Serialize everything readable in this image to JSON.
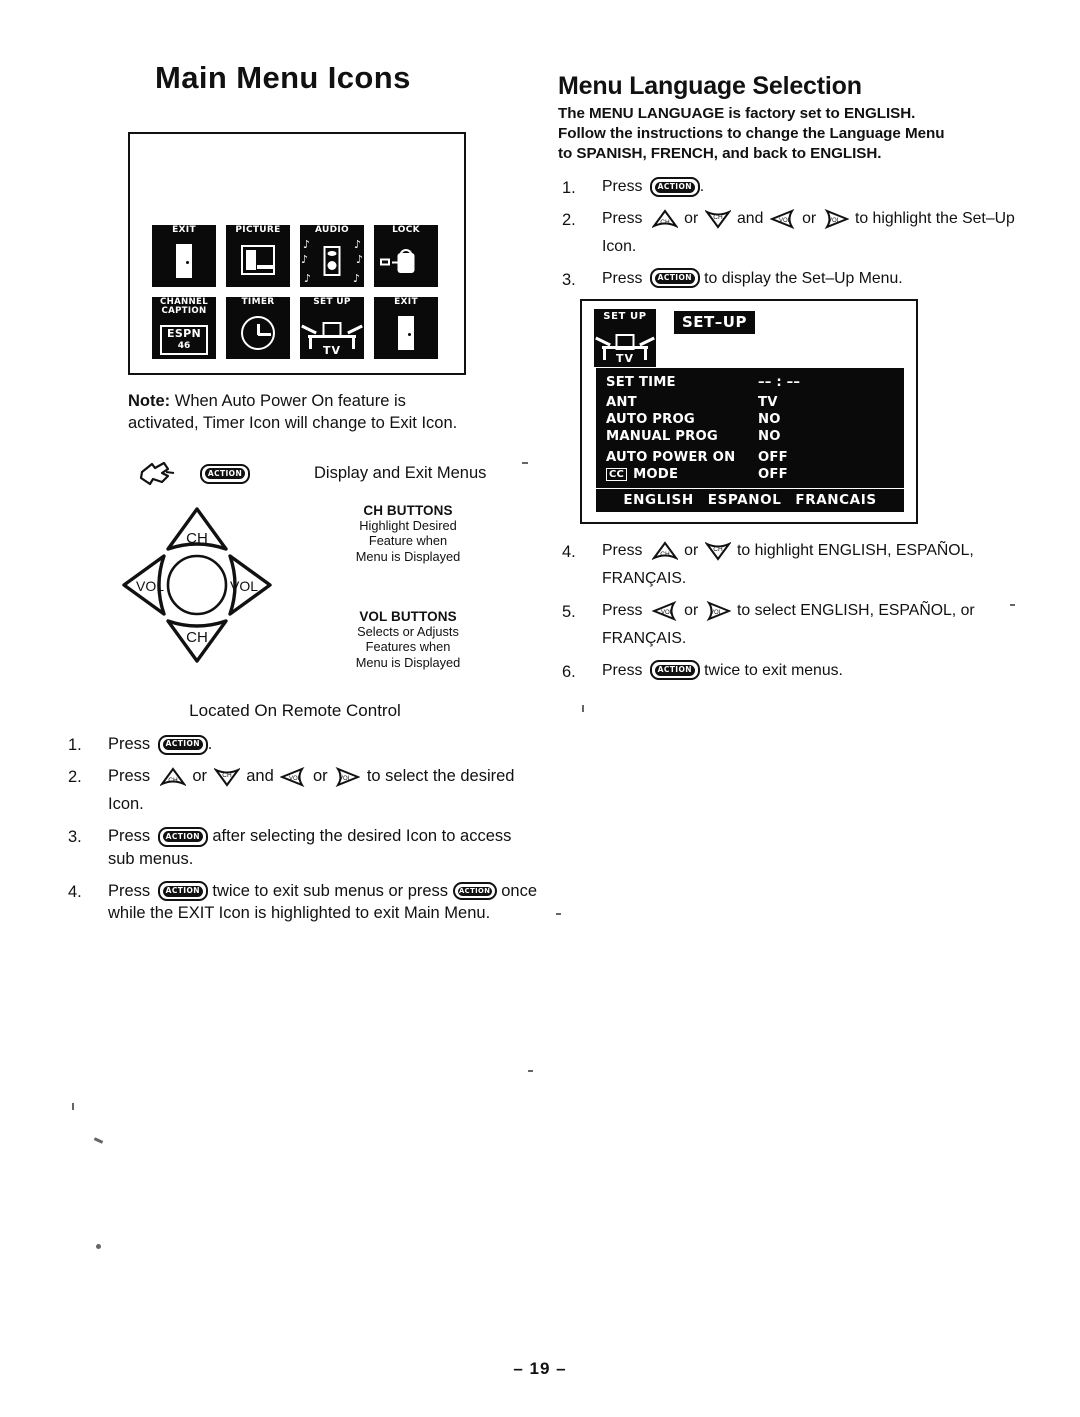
{
  "left_column": {
    "title": "Main Menu Icons",
    "icon_panel": {
      "icons": [
        {
          "label": "EXIT",
          "glyph": "door-icon"
        },
        {
          "label": "PICTURE",
          "glyph": "picture-icon"
        },
        {
          "label": "AUDIO",
          "glyph": "speaker-icon"
        },
        {
          "label": "LOCK",
          "glyph": "padlock-icon"
        },
        {
          "label": "CHANNEL CAPTION",
          "label_line1": "CHANNEL",
          "label_line2": "CAPTION",
          "glyph": "caption-icon",
          "caption_network": "ESPN",
          "caption_channel": "46"
        },
        {
          "label": "TIMER",
          "glyph": "clock-icon"
        },
        {
          "label": "SET UP",
          "glyph": "tv-stand-icon",
          "stand_word": "TV"
        },
        {
          "label": "EXIT",
          "glyph": "door-icon"
        }
      ]
    },
    "note": {
      "prefix": "Note:",
      "text": " When Auto Power On feature is activated, Timer Icon will change to Exit Icon."
    },
    "legend": {
      "action_button_label": "ACTION",
      "caption": "Display and Exit Menus"
    },
    "remote": {
      "ch_up_label": "CH",
      "ch_down_label": "CH",
      "vol_left_label": "VOL",
      "vol_right_label": "VOL",
      "ch_buttons": {
        "heading": "CH BUTTONS",
        "lines": [
          "Highlight Desired",
          "Feature when",
          "Menu is Displayed"
        ]
      },
      "vol_buttons": {
        "heading": "VOL BUTTONS",
        "lines": [
          "Selects or Adjusts",
          "Features when",
          "Menu is Displayed"
        ]
      },
      "footer": "Located On Remote Control"
    },
    "steps": [
      {
        "num": "1.",
        "parts": [
          "Press ",
          "[ACTION]",
          "."
        ]
      },
      {
        "num": "2.",
        "parts": [
          "Press ",
          "[CH-UP]",
          " or ",
          "[CH-DOWN]",
          " and ",
          "[VOL-LEFT]",
          " or ",
          "[VOL-RIGHT]",
          " to select the desired Icon."
        ]
      },
      {
        "num": "3.",
        "parts": [
          "Press ",
          "[ACTION]",
          " after selecting the desired Icon to access sub menus."
        ]
      },
      {
        "num": "4.",
        "parts": [
          "Press ",
          "[ACTION]",
          " twice to exit sub menus or press ",
          "[ACTION]",
          " once while the EXIT Icon is highlighted to exit Main Menu."
        ]
      }
    ],
    "step_text": {
      "s1_a": "Press",
      "s1_b": ".",
      "s2_a": "Press",
      "s2_or1": "or",
      "s2_and": "and",
      "s2_or2": "or",
      "s2_tail": "to select the desired Icon.",
      "s3_a": "Press",
      "s3_tail": "after selecting the desired Icon to access sub menus.",
      "s4_a": "Press",
      "s4_mid": "twice to exit sub menus or press",
      "s4_tail": "once while the EXIT Icon is highlighted to exit Main Menu."
    }
  },
  "right_column": {
    "title": "Menu Language Selection",
    "intro_lines": [
      "The MENU LANGUAGE  is factory set to ENGLISH.",
      "Follow the instructions to change the Language Menu",
      "to SPANISH, FRENCH, and back to ENGLISH."
    ],
    "step_text": {
      "s1_a": "Press",
      "s1_b": ".",
      "s2_a": "Press",
      "s2_or1": "or",
      "s2_and": "and",
      "s2_or2": "or",
      "s2_tail": "to highlight the Set–Up Icon.",
      "s3_a": "Press",
      "s3_tail": "to display the Set–Up Menu.",
      "s4_a": "Press",
      "s4_or": "or",
      "s4_tail": "to highlight ENGLISH, ESPAÑOL, FRANÇAIS.",
      "s5_a": "Press",
      "s5_or": "or",
      "s5_tail": "to select ENGLISH, ESPAÑOL, or FRANÇAIS.",
      "s6_a": "Press",
      "s6_tail": "twice to exit menus."
    },
    "step_numbers": [
      "1.",
      "2.",
      "3.",
      "4.",
      "5.",
      "6."
    ],
    "tv_screen": {
      "icon_label": "SET UP",
      "icon_stand_word": "TV",
      "title_tag": "SET–UP",
      "menu_rows": [
        {
          "key": "SET TIME",
          "value": "–– : ––"
        },
        {
          "key": "ANT",
          "value": "TV"
        },
        {
          "key": "AUTO PROG",
          "value": "NO"
        },
        {
          "key": "MANUAL PROG",
          "value": "NO"
        },
        {
          "key": "AUTO POWER ON",
          "value": "OFF"
        },
        {
          "key": "MODE",
          "value": "OFF",
          "badge": "CC"
        }
      ],
      "languages": [
        "ENGLISH",
        "ESPANOL",
        "FRANCAIS"
      ]
    }
  },
  "footer": {
    "page_number": "– 19 –"
  },
  "colors": {
    "ink": "#111111",
    "paper": "#ffffff",
    "icon_bg": "#0a0a0a"
  }
}
